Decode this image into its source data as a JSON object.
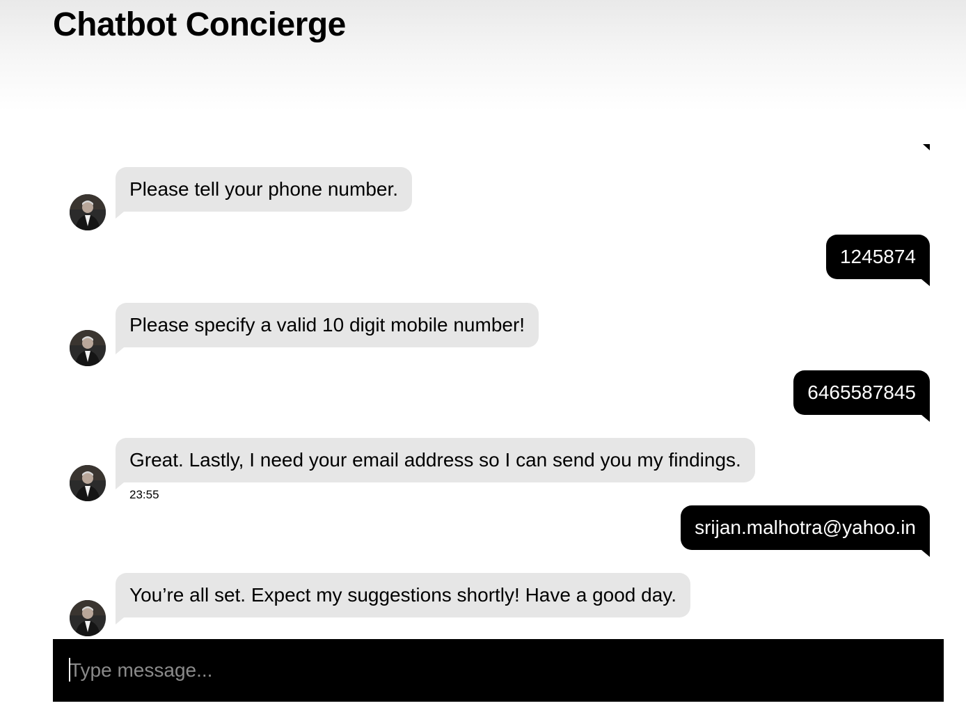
{
  "header": {
    "title": "Chatbot Concierge"
  },
  "messages": [
    {
      "sender": "bot",
      "text": "Please tell your phone number."
    },
    {
      "sender": "user",
      "text": "1245874"
    },
    {
      "sender": "bot",
      "text": "Please specify a valid 10 digit mobile number!"
    },
    {
      "sender": "user",
      "text": "6465587845"
    },
    {
      "sender": "bot",
      "text": "Great. Lastly, I need your email address so I can send you my findings.",
      "time": "23:55"
    },
    {
      "sender": "user",
      "text": "srijan.malhotra@yahoo.in"
    },
    {
      "sender": "bot",
      "text": "You’re all set. Expect my suggestions shortly! Have a good day."
    }
  ],
  "composer": {
    "placeholder": "Type message...",
    "value": ""
  },
  "colors": {
    "bot_bubble": "#e6e6e6",
    "user_bubble": "#000000",
    "composer_bg": "#000000",
    "header_gradient_top": "#e9e9e9"
  },
  "icons": {
    "bot_avatar": "bot-avatar-photo"
  }
}
